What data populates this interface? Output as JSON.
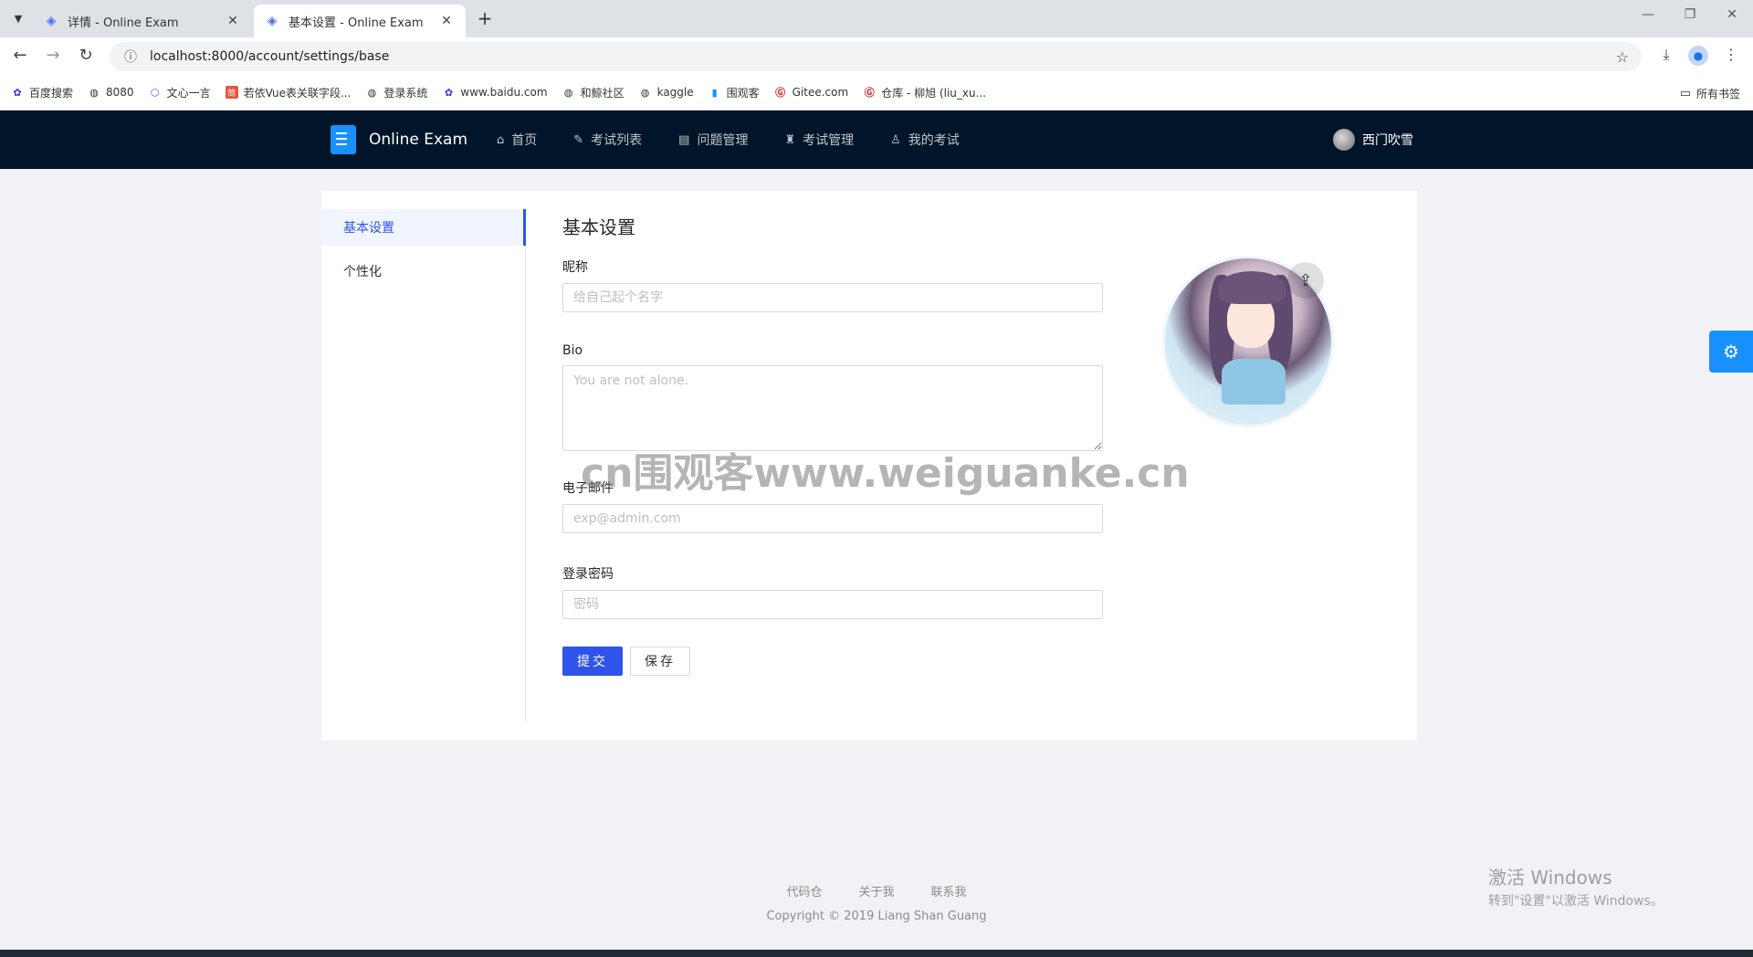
{
  "browser": {
    "tabs": [
      {
        "title": "详情 - Online Exam",
        "active": false
      },
      {
        "title": "基本设置 - Online Exam",
        "active": true
      }
    ],
    "url": "localhost:8000/account/settings/base",
    "bookmarks": [
      {
        "label": "百度搜索",
        "icon": "paw-icon"
      },
      {
        "label": "8080",
        "icon": "globe-icon"
      },
      {
        "label": "文心一言",
        "icon": "bot-icon"
      },
      {
        "label": "若依Vue表关联字段...",
        "icon": "jian-icon"
      },
      {
        "label": "登录系统",
        "icon": "globe-icon"
      },
      {
        "label": "www.baidu.com",
        "icon": "paw-icon"
      },
      {
        "label": "和鲸社区",
        "icon": "globe-icon"
      },
      {
        "label": "kaggle",
        "icon": "globe-icon"
      },
      {
        "label": "围观客",
        "icon": "bookmark-icon"
      },
      {
        "label": "Gitee.com",
        "icon": "gitee-icon"
      },
      {
        "label": "仓库 - 柳旭 (liu_xu...",
        "icon": "gitee-icon"
      }
    ],
    "all_bookmarks": "所有书签"
  },
  "app": {
    "logo_title": "Online Exam",
    "nav": [
      {
        "label": "首页",
        "icon": "home-icon"
      },
      {
        "label": "考试列表",
        "icon": "pencil-icon"
      },
      {
        "label": "问题管理",
        "icon": "book-icon"
      },
      {
        "label": "考试管理",
        "icon": "cap-icon"
      },
      {
        "label": "我的考试",
        "icon": "user-icon"
      }
    ],
    "username": "西门吹雪"
  },
  "settings": {
    "menu": [
      {
        "label": "基本设置",
        "active": true
      },
      {
        "label": "个性化",
        "active": false
      }
    ],
    "title": "基本设置",
    "nickname_label": "昵称",
    "nickname_placeholder": "给自己起个名字",
    "bio_label": "Bio",
    "bio_placeholder": "You are not alone.",
    "email_label": "电子邮件",
    "email_placeholder": "exp@admin.com",
    "password_label": "登录密码",
    "password_placeholder": "密码",
    "submit_label": "提交",
    "save_label": "保存"
  },
  "watermark": "cn围观客www.weiguanke.cn",
  "footer": {
    "links": [
      "代码仓",
      "关于我",
      "联系我"
    ],
    "copyright": "Copyright © 2019 Liang Shan Guang"
  },
  "windows_activation": {
    "line1": "激活 Windows",
    "line2": "转到\"设置\"以激活 Windows。"
  }
}
